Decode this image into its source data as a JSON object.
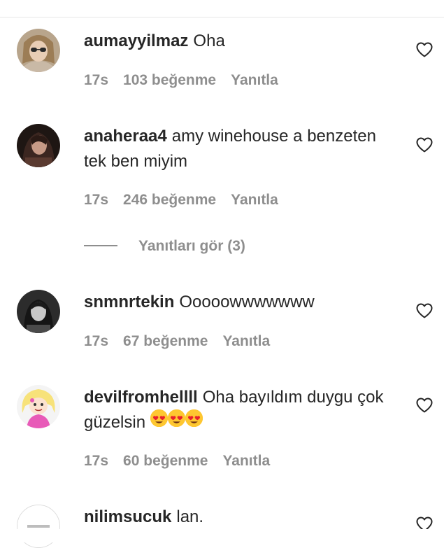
{
  "comments": [
    {
      "username": "aumayyilmaz",
      "text": "Oha",
      "time": "17s",
      "likes": "103 beğenme",
      "reply": "Yanıtla",
      "avatar": "user-avatar-photo"
    },
    {
      "username": "anaheraa4",
      "text": "amy winehouse a benzeten tek ben miyim",
      "time": "17s",
      "likes": "246 beğenme",
      "reply": "Yanıtla",
      "avatar": "user-avatar-photo",
      "view_replies": "Yanıtları gör (3)"
    },
    {
      "username": "snmnrtekin",
      "text": "Ooooowwwwwww",
      "time": "17s",
      "likes": "67 beğenme",
      "reply": "Yanıtla",
      "avatar": "user-avatar-photo"
    },
    {
      "username": "devilfromhellll",
      "text": "Oha bayıldım duygu çok güzelsin",
      "emoji": [
        "heart-eyes-emoji",
        "heart-eyes-emoji",
        "heart-eyes-emoji"
      ],
      "time": "17s",
      "likes": "60 beğenme",
      "reply": "Yanıtla",
      "avatar": "cartoon-avatar"
    },
    {
      "username": "nilimsucuk",
      "text": "lan.",
      "avatar": "logo-avatar"
    }
  ],
  "icons": {
    "like": "heart-outline-icon"
  },
  "colors": {
    "text": "#262626",
    "meta": "#8e8e8e",
    "divider": "#e6e6e6"
  }
}
